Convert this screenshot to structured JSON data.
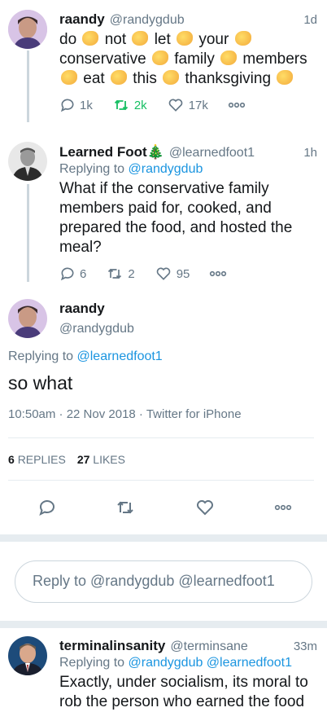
{
  "tweet1": {
    "name": "raandy",
    "handle": "@randygdub",
    "time": "1d",
    "words": [
      "do",
      "not",
      "let",
      "your",
      "conservative",
      "family",
      "members",
      "eat",
      "this",
      "thanksgiving"
    ],
    "replies": "1k",
    "retweets": "2k",
    "likes": "17k"
  },
  "tweet2": {
    "name": "Learned Foot",
    "emoji": "🎄",
    "handle": "@learnedfoot1",
    "time": "1h",
    "replying_label": "Replying to",
    "replying_to": "@randygdub",
    "text": "What if the conservative family members paid for, cooked, and prepared the food, and hosted the meal?",
    "replies": "6",
    "retweets": "2",
    "likes": "95"
  },
  "main": {
    "name": "raandy",
    "handle": "@randygdub",
    "replying_label": "Replying to",
    "replying_to": "@learnedfoot1",
    "text": "so what",
    "meta": "10:50am · 22 Nov 2018 · Twitter for iPhone",
    "replies_count": "6",
    "replies_label": "REPLIES",
    "likes_count": "27",
    "likes_label": "LIKES"
  },
  "composer": {
    "placeholder": "Reply to @randygdub @learnedfoot1"
  },
  "tweet3": {
    "name": "terminalinsanity",
    "handle": "@terminsane",
    "time": "33m",
    "replying_label": "Replying to",
    "replying_to": "@randygdub @learnedfoot1",
    "text": "Exactly, under socialism, its moral to",
    "text2": "rob the person who earned the food"
  },
  "colors": {
    "accent": "#1b95e0",
    "retweet": "#17bf63",
    "muted": "#657786"
  }
}
